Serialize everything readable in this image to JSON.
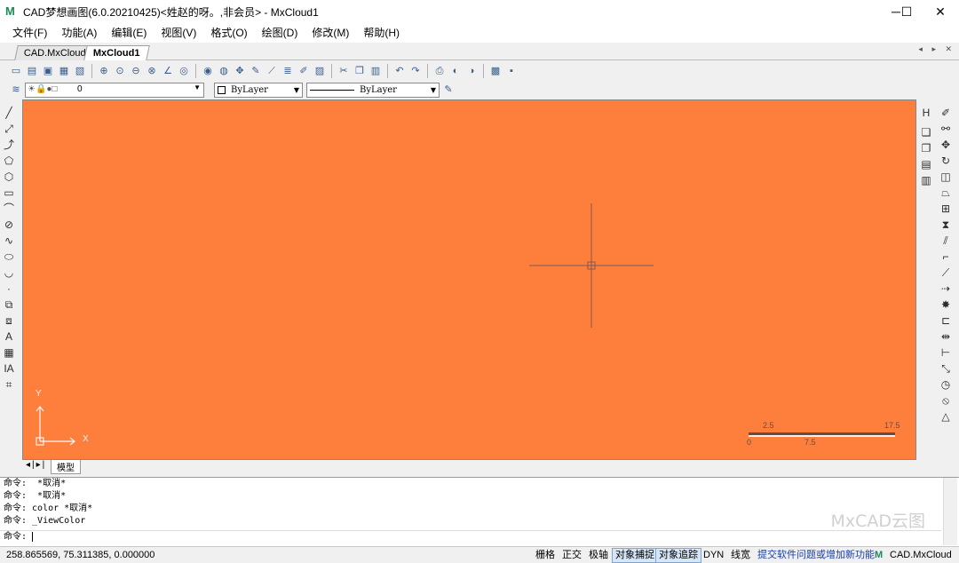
{
  "window": {
    "title": "CAD梦想画图(6.0.20210425)<姓赵的呀。,非会员> - MxCloud1",
    "app_icon": "mxcad-logo-icon",
    "minimize": "─",
    "maximize": "☐",
    "close": "✕"
  },
  "menu": [
    "文件(F)",
    "功能(A)",
    "编辑(E)",
    "视图(V)",
    "格式(O)",
    "绘图(D)",
    "修改(M)",
    "帮助(H)"
  ],
  "doc_tabs": [
    "CAD.MxCloud",
    "MxCloud1"
  ],
  "tab_nav": "◂ ▸ ✕",
  "toolbar2": {
    "layer": "0",
    "color": "ByLayer",
    "linetype": "ByLayer"
  },
  "canvas": {
    "bg": "#fe7f3c",
    "axis_y": "Y",
    "axis_x": "X",
    "scale_top": [
      "2.5",
      "17.5"
    ],
    "scale_bottom": [
      "0",
      "7.5"
    ]
  },
  "layout_tabs": {
    "model": "模型"
  },
  "command_lines": [
    "命令:  *取消*",
    "命令:  *取消*",
    "命令: color *取消*",
    "命令: _ViewColor"
  ],
  "command_prompt": "命令:",
  "watermark": "MxCAD云图",
  "status": {
    "coords": "258.865569,  75.311385,  0.000000",
    "grid": "栅格",
    "ortho": "正交",
    "polar": "极轴",
    "osnap": "对象捕捉",
    "otrack": "对象追踪",
    "dyn": "DYN",
    "lw": "线宽",
    "link": "提交软件问题或增加新功能",
    "brand": "CAD.MxCloud"
  }
}
